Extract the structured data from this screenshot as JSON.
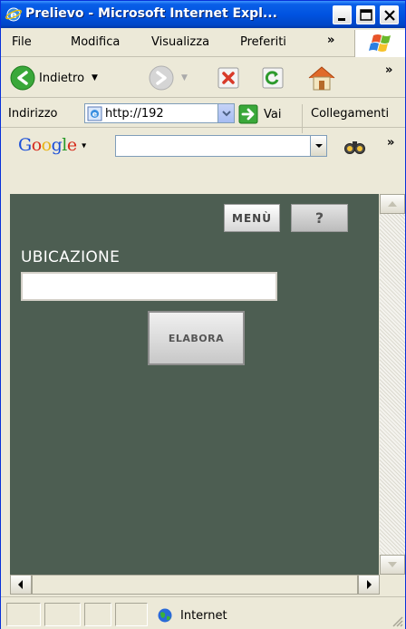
{
  "window": {
    "title": "Prelievo - Microsoft Internet Expl..."
  },
  "menubar": {
    "items": [
      "File",
      "Modifica",
      "Visualizza",
      "Preferiti"
    ],
    "more": "»"
  },
  "toolbar": {
    "back_label": "Indietro",
    "more": "»"
  },
  "addressbar": {
    "label": "Indirizzo",
    "url": "http://192",
    "go_label": "Vai",
    "links_label": "Collegamenti"
  },
  "googlebar": {
    "logo": "Google",
    "search_value": "",
    "more": "»"
  },
  "page": {
    "menu_button": "MENÙ",
    "help_button": "?",
    "field_label": "UBICAZIONE",
    "field_value": "",
    "submit_button": "ELABORA",
    "background_color": "#4d5e52"
  },
  "statusbar": {
    "zone": "Internet"
  },
  "icons": {
    "title": "ie-icon",
    "back": "back-arrow-icon",
    "forward": "forward-arrow-icon",
    "stop": "stop-icon",
    "refresh": "refresh-icon",
    "home": "home-icon",
    "go": "go-arrow-icon",
    "zone": "globe-icon"
  }
}
